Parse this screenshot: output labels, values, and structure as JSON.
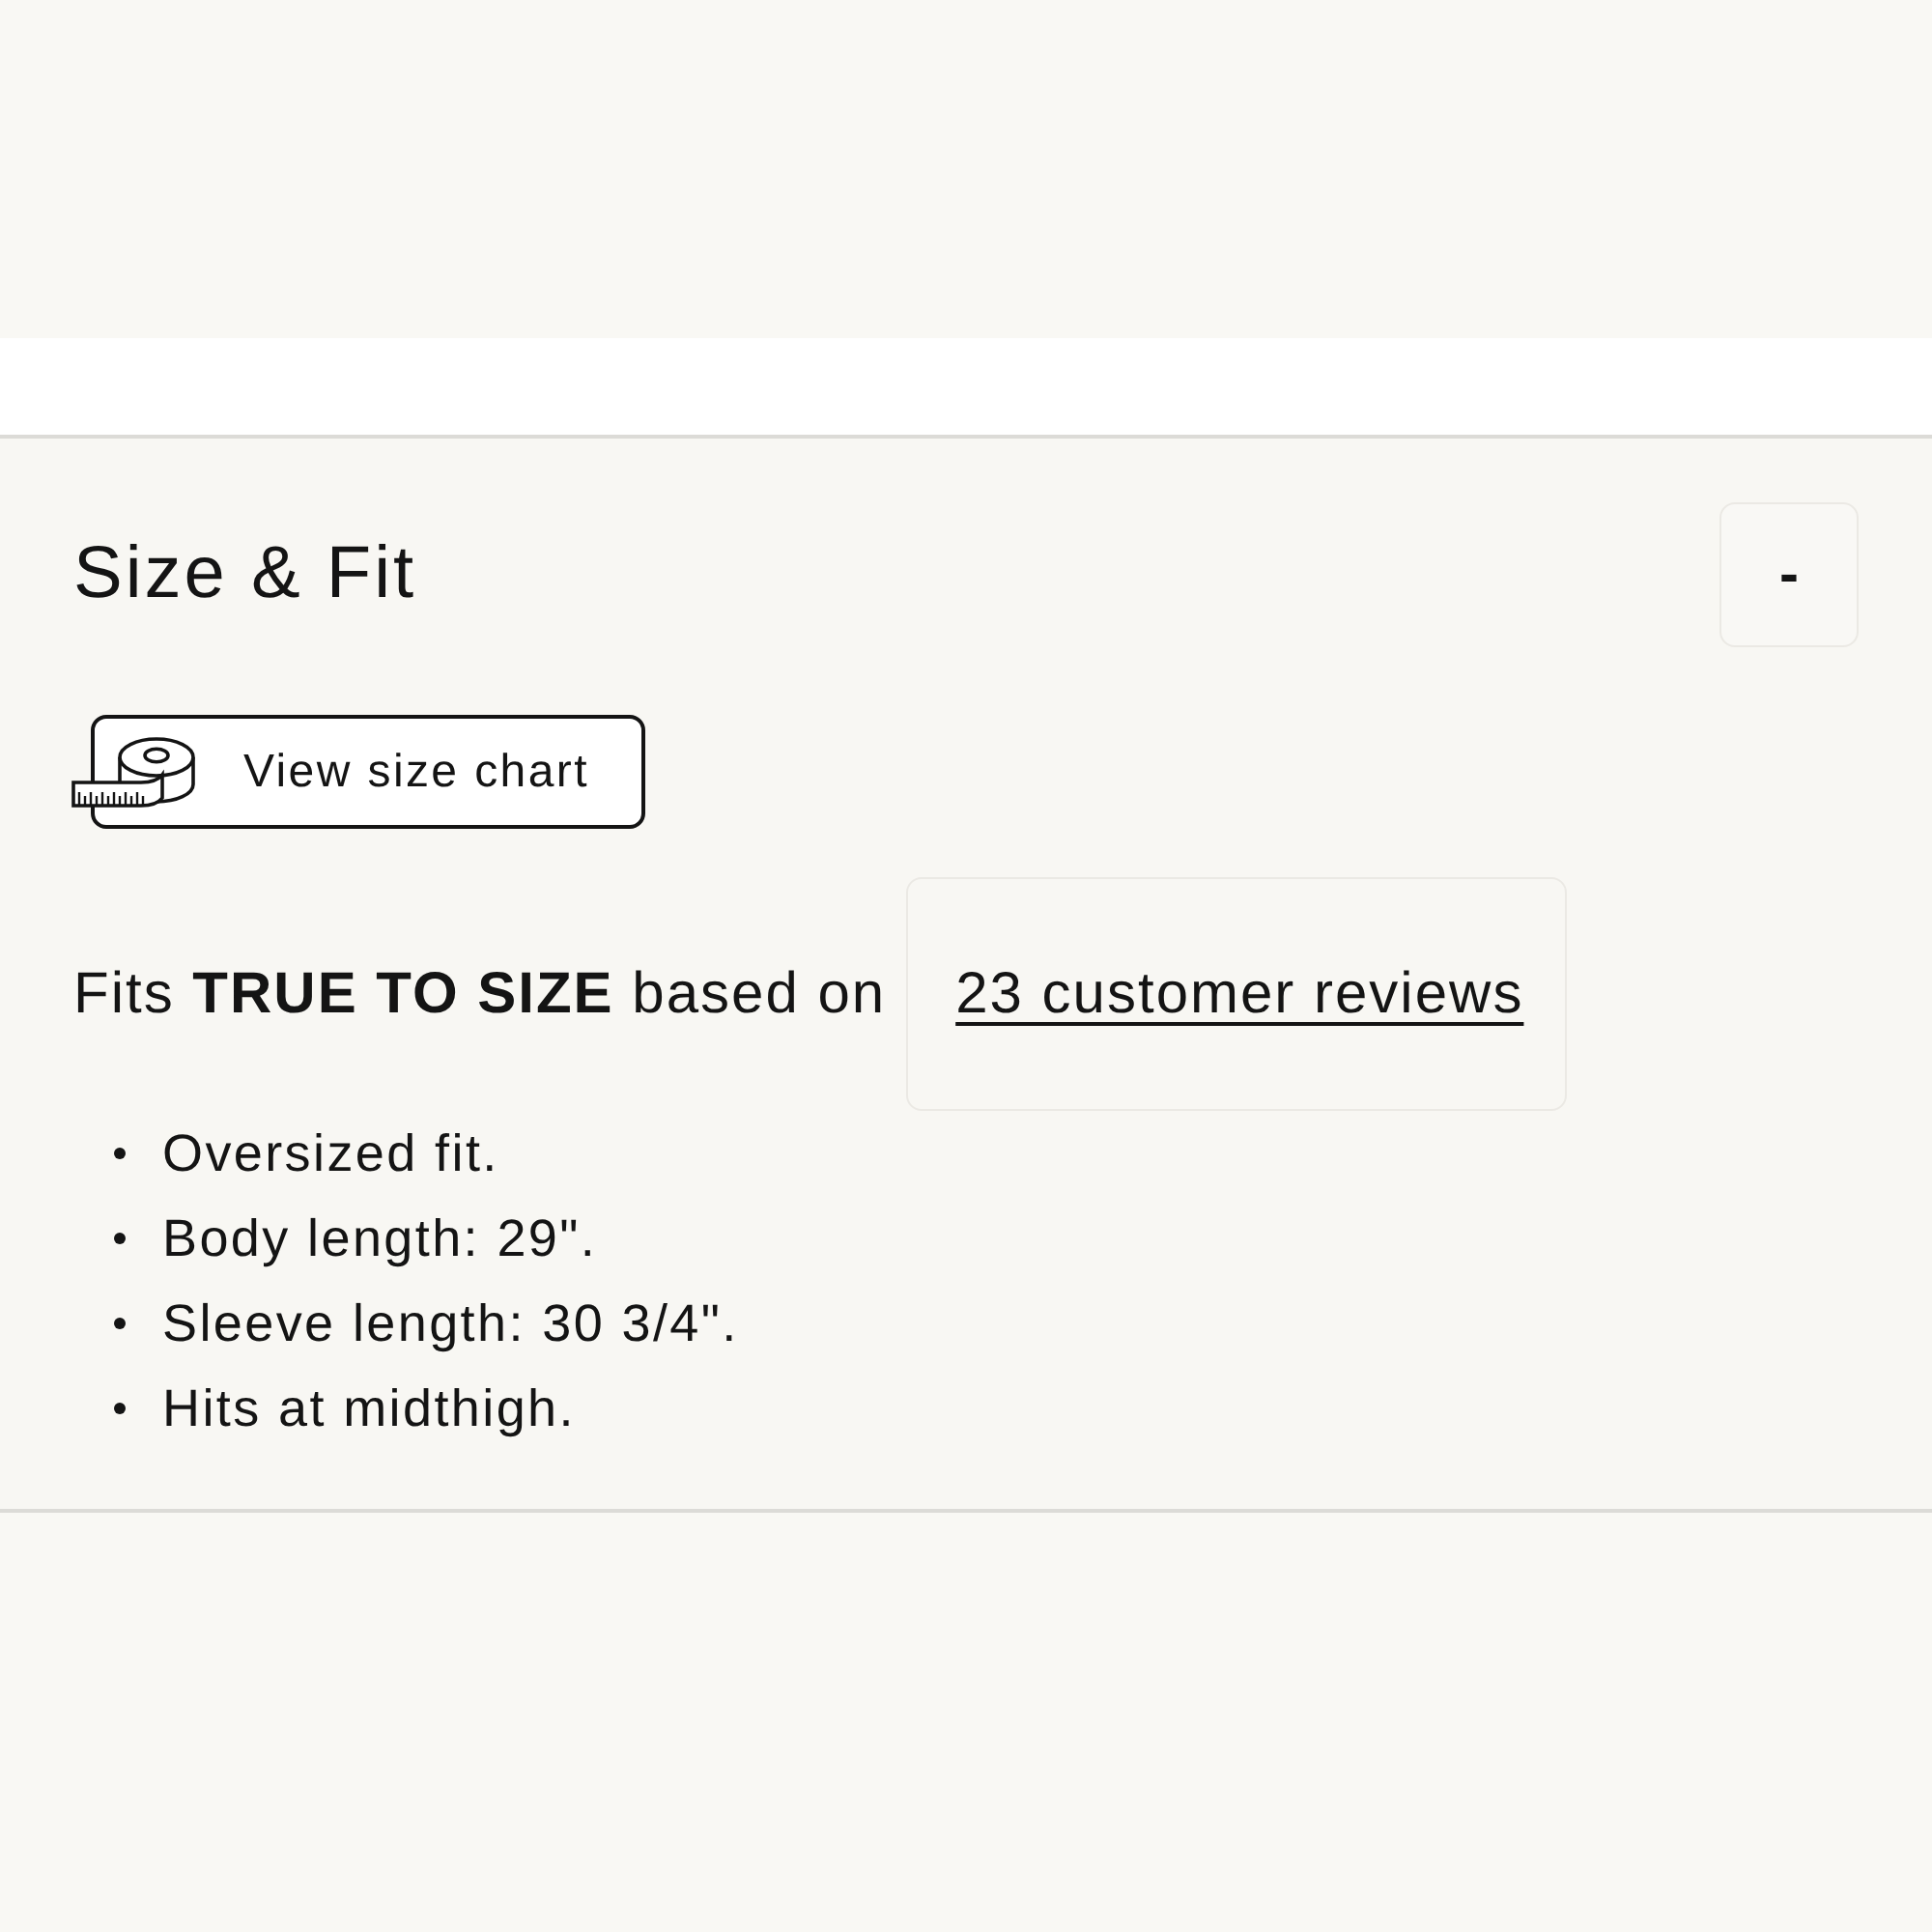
{
  "section": {
    "title": "Size & Fit",
    "toggle": {
      "label": "-"
    },
    "size_chart_button": {
      "label": "View size chart"
    },
    "fit_summary": {
      "text": "Fits **TRUE TO SIZE** based on",
      "reviews_link": "23 customer reviews"
    },
    "details": [
      "Oversized fit.",
      "Body length: 29\".",
      "Sleeve length: 30 3/4\".",
      "Hits at midthigh."
    ]
  }
}
